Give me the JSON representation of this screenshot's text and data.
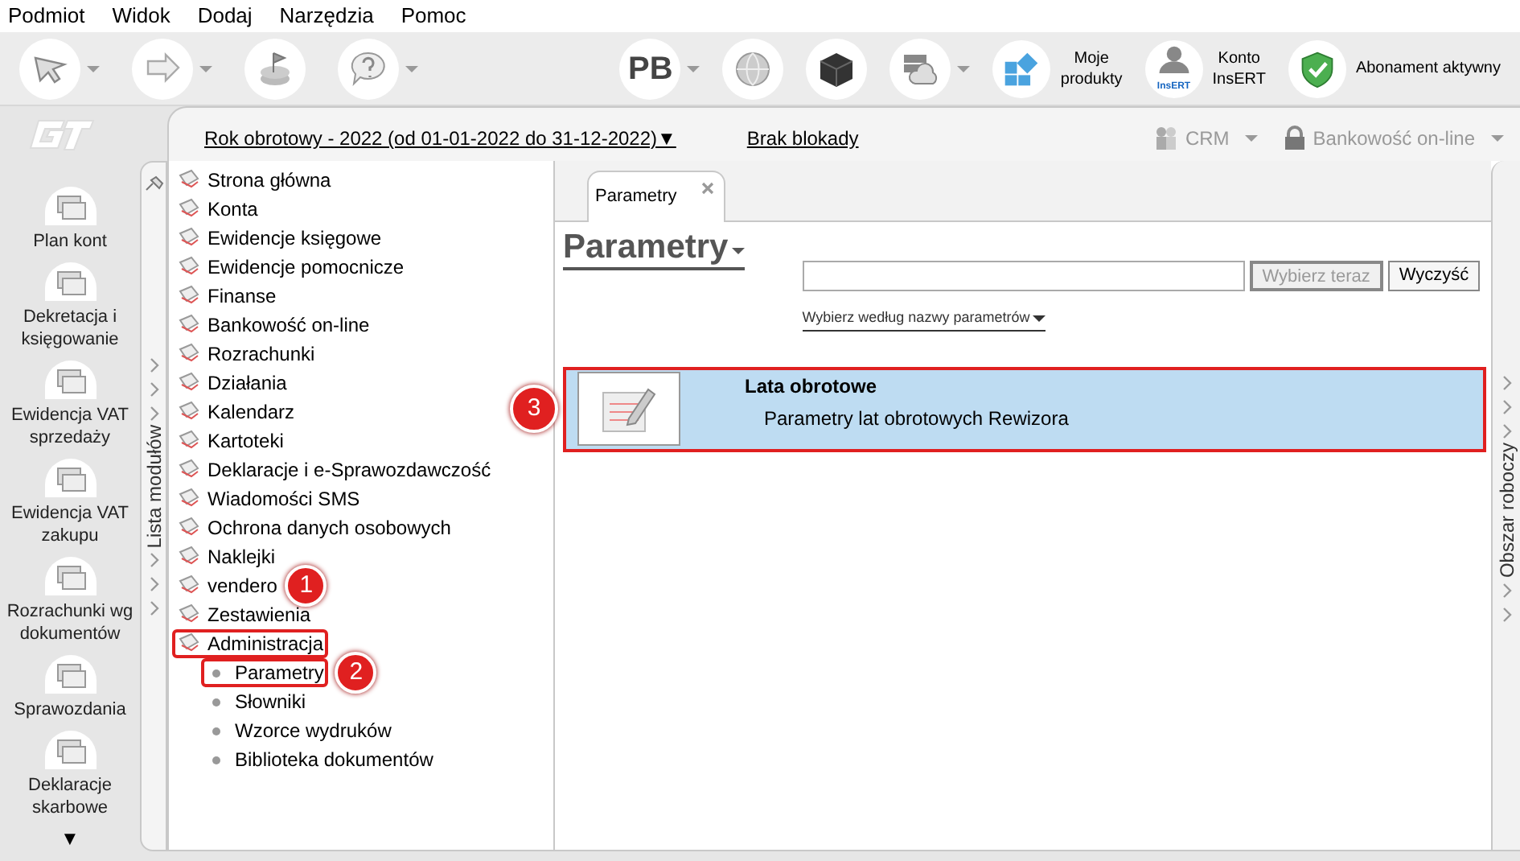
{
  "menu": [
    {
      "label": "Podmiot"
    },
    {
      "label": "Widok"
    },
    {
      "label": "Dodaj"
    },
    {
      "label": "Narzędzia"
    },
    {
      "label": "Pomoc"
    }
  ],
  "toolbar": {
    "left": [
      {
        "kind": "pointer",
        "caret": true
      },
      {
        "kind": "arrow",
        "caret": true
      },
      {
        "kind": "flag",
        "caret": false
      },
      {
        "kind": "help",
        "caret": true
      }
    ],
    "right": [
      {
        "kind": "text",
        "label": "PB",
        "caret": true
      },
      {
        "kind": "globe",
        "caret": false
      },
      {
        "kind": "cube",
        "caret": false
      },
      {
        "kind": "cloud",
        "caret": true
      },
      {
        "kind": "tiles",
        "lines": [
          "Moje",
          "produkty"
        ]
      },
      {
        "kind": "account",
        "badge": "InsERT",
        "lines": [
          "Konto",
          "InsERT"
        ]
      },
      {
        "kind": "shield",
        "lines": [
          "Abonament aktywny"
        ]
      }
    ]
  },
  "header": {
    "fiscal_year": "Rok obrotowy - 2022  (od 01-01-2022 do 31-12-2022)",
    "fiscal_caret": "▼",
    "lock_status": "Brak blokady",
    "links": [
      {
        "kind": "crm",
        "label": "CRM",
        "disabled": true
      },
      {
        "kind": "bank",
        "label": "Bankowość on-line",
        "disabled": true
      }
    ]
  },
  "rail": {
    "items": [
      {
        "label": "Plan kont"
      },
      {
        "label": "Dekretacja i księgowanie"
      },
      {
        "label": "Ewidencja VAT sprzedaży"
      },
      {
        "label": "Ewidencja VAT zakupu"
      },
      {
        "label": "Rozrachunki wg dokumentów"
      },
      {
        "label": "Sprawozdania"
      },
      {
        "label": "Deklaracje skarbowe"
      }
    ],
    "more": "▼"
  },
  "module_list": {
    "title": "Lista modułów",
    "items": [
      {
        "label": "Strona główna",
        "highlighted": false
      },
      {
        "label": "Konta",
        "highlighted": false
      },
      {
        "label": "Ewidencje księgowe",
        "highlighted": false
      },
      {
        "label": "Ewidencje pomocnicze",
        "highlighted": false
      },
      {
        "label": "Finanse",
        "highlighted": false
      },
      {
        "label": "Bankowość on-line",
        "highlighted": false
      },
      {
        "label": "Rozrachunki",
        "highlighted": false
      },
      {
        "label": "Działania",
        "highlighted": false
      },
      {
        "label": "Kalendarz",
        "highlighted": false
      },
      {
        "label": "Kartoteki",
        "highlighted": false
      },
      {
        "label": "Deklaracje i e-Sprawozdawczość",
        "highlighted": false
      },
      {
        "label": "Wiadomości SMS",
        "highlighted": false
      },
      {
        "label": "Ochrona danych osobowych",
        "highlighted": false
      },
      {
        "label": "Naklejki",
        "highlighted": false
      },
      {
        "label": "vendero",
        "highlighted": false,
        "callout": "1"
      },
      {
        "label": "Zestawienia",
        "highlighted": false
      },
      {
        "label": "Administracja",
        "highlighted": true,
        "expanded": true,
        "children": [
          {
            "label": "Parametry",
            "highlighted": true,
            "callout": "2"
          },
          {
            "label": "Słowniki",
            "highlighted": false
          },
          {
            "label": "Wzorce wydruków",
            "highlighted": false
          },
          {
            "label": "Biblioteka dokumentów",
            "highlighted": false
          }
        ]
      }
    ]
  },
  "tabs": [
    {
      "label": "Parametry",
      "selected": true
    }
  ],
  "page": {
    "title": "Parametry",
    "buttons": [
      {
        "label": "Wybierz teraz",
        "disabled": true
      },
      {
        "label": "Wyczyść",
        "disabled": false
      }
    ],
    "filter": "Wybierz według nazwy parametrów",
    "results": [
      {
        "title": "Lata obrotowe",
        "description": "Parametry lat obrotowych Rewizora",
        "selected": true,
        "highlighted": true,
        "callout": "3"
      }
    ]
  },
  "workspace": {
    "title": "Obszar roboczy"
  }
}
